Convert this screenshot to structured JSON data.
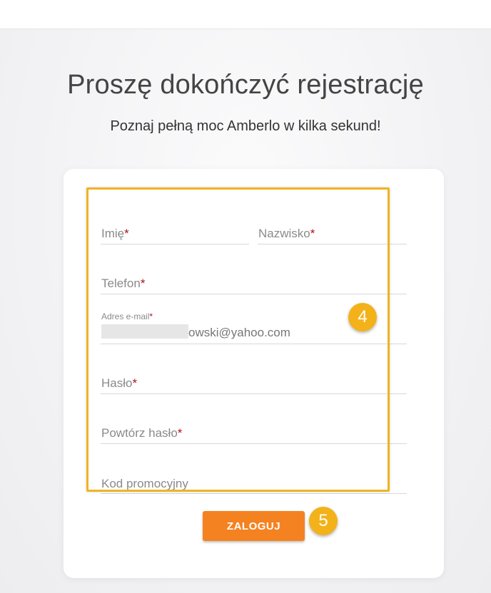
{
  "header": {
    "title": "Proszę dokończyć rejestrację",
    "subtitle": "Poznaj pełną moc Amberlo w kilka sekund!"
  },
  "form": {
    "first_name_label": "Imię",
    "last_name_label": "Nazwisko",
    "phone_label": "Telefon",
    "email_label": "Adres e-mail",
    "email_value": "owski@yahoo.com",
    "password_label": "Hasło",
    "repeat_password_label": "Powtórz hasło",
    "promo_label": "Kod promocyjny",
    "required_mark": "*",
    "submit_label": "ZALOGUJ"
  },
  "annotations": {
    "form_step": "4",
    "button_step": "5"
  },
  "colors": {
    "accent": "#f58220",
    "highlight": "#f0b323",
    "required": "#b0121b"
  }
}
